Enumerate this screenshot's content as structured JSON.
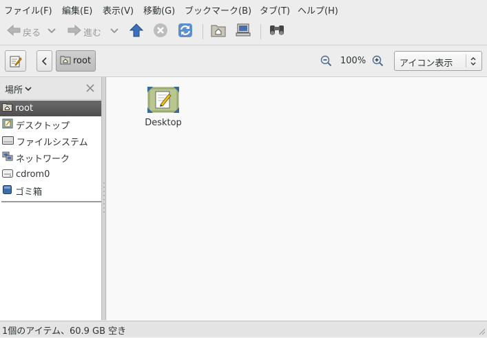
{
  "menubar": {
    "items": [
      {
        "label": "ファイル(F)"
      },
      {
        "label": "編集(E)"
      },
      {
        "label": "表示(V)"
      },
      {
        "label": "移動(G)"
      },
      {
        "label": "ブックマーク(B)"
      },
      {
        "label": "タブ(T)"
      },
      {
        "label": "ヘルプ(H)"
      }
    ]
  },
  "toolbar": {
    "back_label": "戻る",
    "forward_label": "進む"
  },
  "locationbar": {
    "path_segment": "root",
    "zoom_level": "100%",
    "view_mode": "アイコン表示"
  },
  "sidebar": {
    "header_label": "場所",
    "items": [
      {
        "label": "root",
        "icon": "home-folder-icon"
      },
      {
        "label": "デスクトップ",
        "icon": "desktop-icon"
      },
      {
        "label": "ファイルシステム",
        "icon": "filesystem-icon"
      },
      {
        "label": "ネットワーク",
        "icon": "network-icon"
      },
      {
        "label": "cdrom0",
        "icon": "cdrom-icon"
      },
      {
        "label": "ゴミ箱",
        "icon": "trash-icon"
      }
    ]
  },
  "main": {
    "files": [
      {
        "name": "Desktop",
        "icon": "desktop-folder-icon"
      }
    ]
  },
  "statusbar": {
    "text": "1個のアイテム、60.9 GB 空き"
  },
  "colors": {
    "selection": "#5a5a5a",
    "accent_blue": "#3465a4"
  }
}
